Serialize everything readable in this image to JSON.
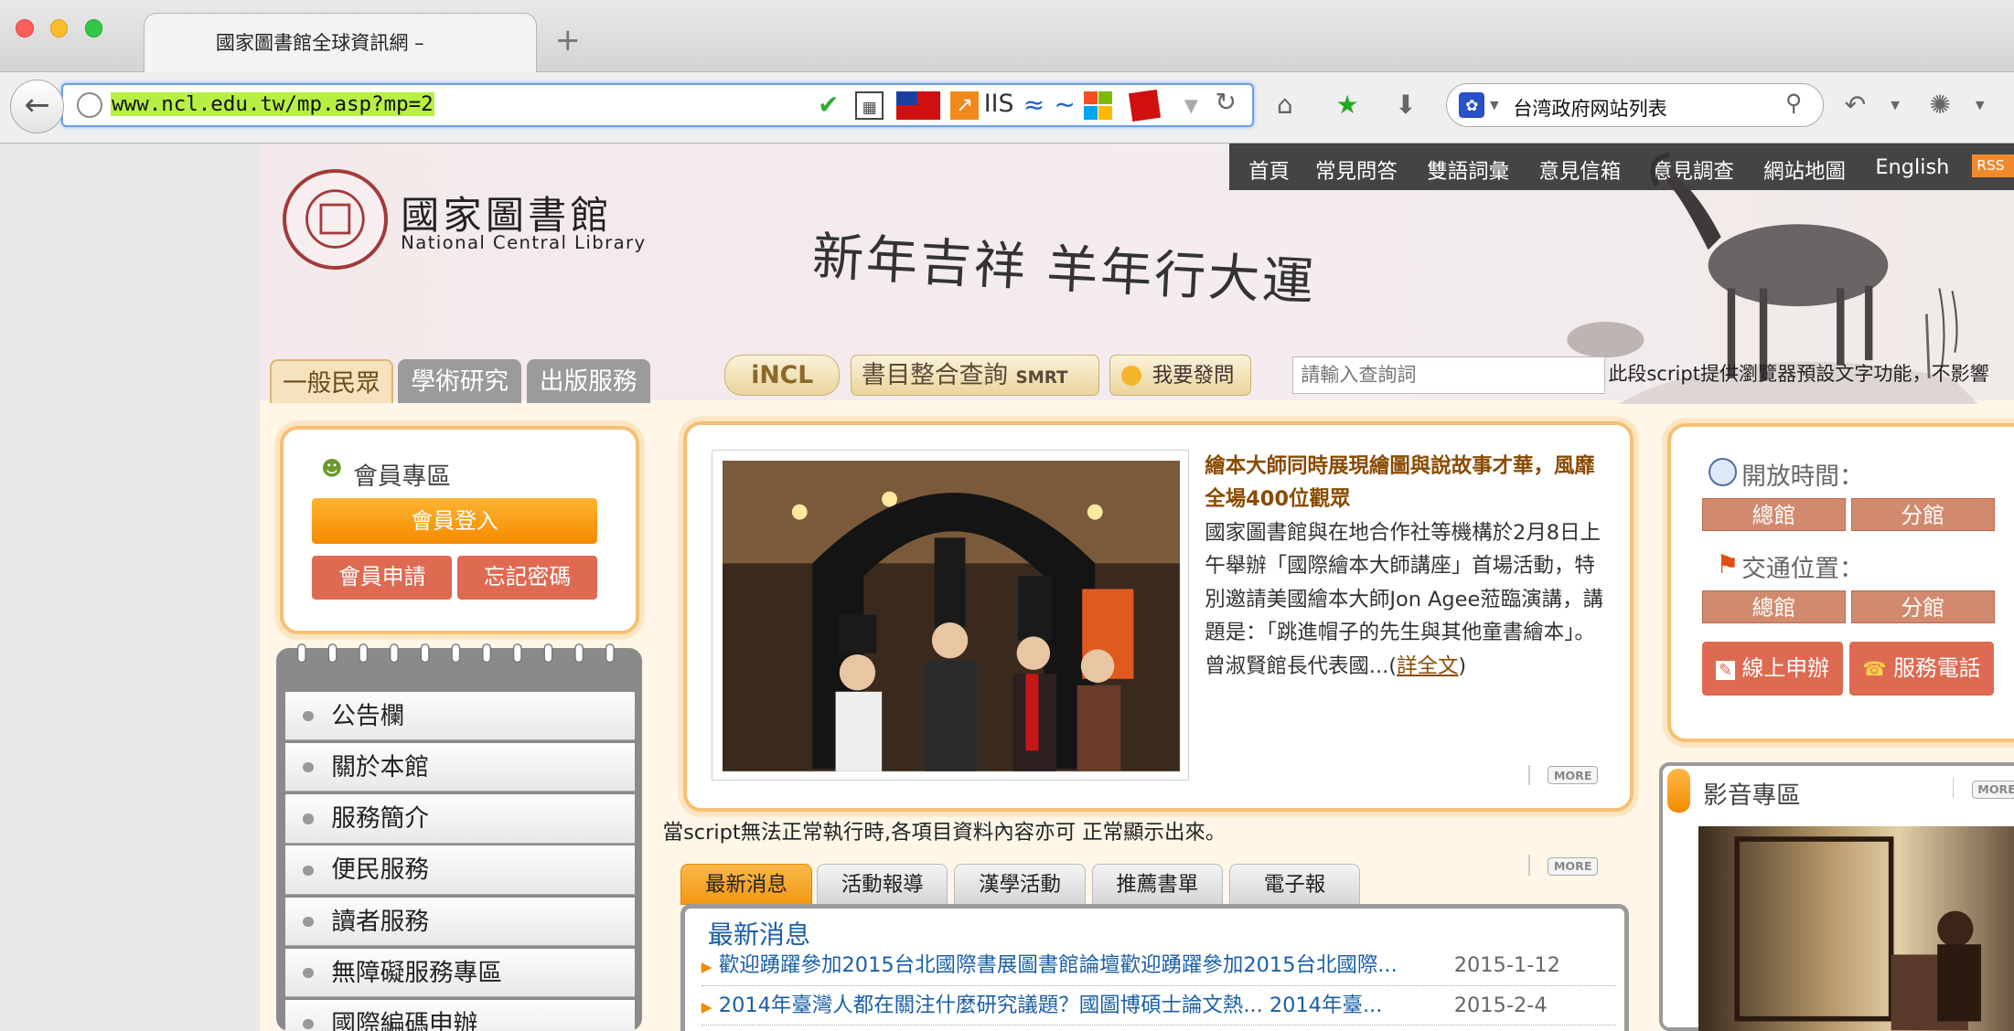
{
  "browser": {
    "tab_title": "國家圖書館全球資訊網 –",
    "new_tab": "+",
    "url": "www.ncl.edu.tw/mp.asp?mp=2",
    "search_engine_text": "台湾政府网站列表"
  },
  "topnav": [
    "首頁",
    "常見問答",
    "雙語詞彙",
    "意見信箱",
    "意見調查",
    "網站地圖",
    "English"
  ],
  "rss": "RSS",
  "logo": {
    "seal_text": "NATIONAL CENTRAL LIBRARY",
    "cn": "國家圖書館",
    "en": "National Central Library"
  },
  "slogan": "新年吉祥  羊年行大運",
  "main_tabs": [
    "一般民眾",
    "學術研究",
    "出版服務"
  ],
  "tools": {
    "incl": "iNCL",
    "smrt_cn": "書目整合查詢",
    "smrt_en": "SMRT",
    "ask": "我要發問"
  },
  "search": {
    "placeholder": "請輸入查詢詞"
  },
  "script_notice": "此段script提供瀏覽器預設文字功能，不影響",
  "member": {
    "title": "會員專區",
    "login": "會員登入",
    "apply": "會員申請",
    "forgot": "忘記密碼"
  },
  "side_nav": [
    "公告欄",
    "關於本館",
    "服務簡介",
    "便民服務",
    "讀者服務",
    "無障礙服務專區",
    "國際編碼申辦"
  ],
  "feature": {
    "title": "繪本大師同時展現繪圖與說故事才華，風靡全場400位觀眾",
    "body": "國家圖書館與在地合作社等機構於2月8日上午舉辦「國際繪本大師講座」首場活動，特別邀請美國繪本大師Jon Agee蒞臨演講，講題是：「跳進帽子的先生與其他童書繪本」。曾淑賢館長代表國...(",
    "link": "詳全文",
    "close": ")",
    "more": "MORE"
  },
  "noscript": "當script無法正常執行時,各項目資料內容亦可 正常顯示出來。",
  "news": {
    "tabs": [
      "最新消息",
      "活動報導",
      "漢學活動",
      "推薦書單",
      "電子報"
    ],
    "heading": "最新消息",
    "more": "MORE",
    "items": [
      {
        "title": "歡迎踴躍參加2015台北國際書展圖書館論壇歡迎踴躍參加2015台北國際...",
        "date": "2015-1-12"
      },
      {
        "title": "2014年臺灣人都在關注什麼研究議題？國圖博碩士論文熱... 2014年臺...",
        "date": "2015-2-4"
      }
    ]
  },
  "right": {
    "hours": "開放時間：",
    "main": "總館",
    "branch": "分館",
    "traffic": "交通位置：",
    "online": "線上申辦",
    "phone": "服務電話"
  },
  "av": {
    "title": "影音專區",
    "more": "MORE"
  },
  "colors": {
    "accent": "#f5a623",
    "topnav": "#444444",
    "link": "#1a5fa8",
    "active_tab": "#f7a21b"
  }
}
